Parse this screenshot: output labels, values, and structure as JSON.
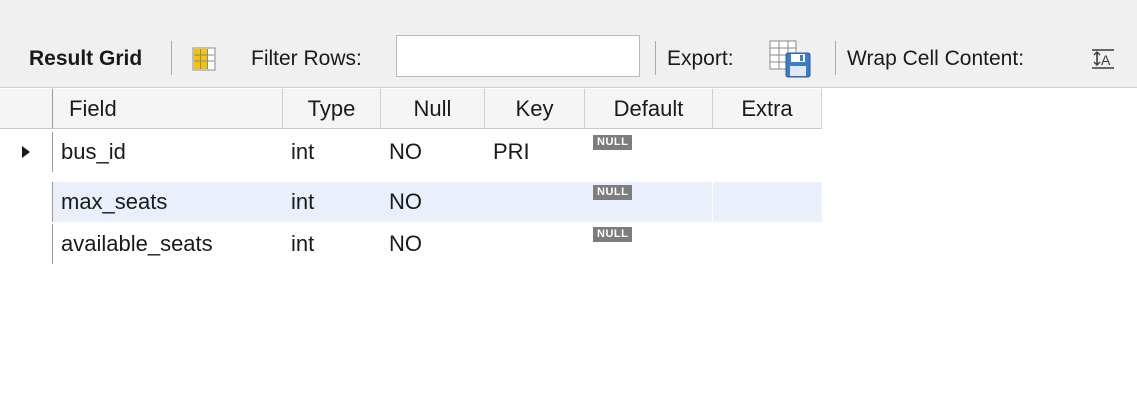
{
  "toolbar": {
    "result_grid_label": "Result Grid",
    "filter_rows_label": "Filter Rows:",
    "filter_rows_value": "",
    "export_label": "Export:",
    "wrap_label": "Wrap Cell Content:",
    "grid_icon": "grid-layout-icon",
    "export_icon": "export-save-icon",
    "wrap_icon": "wrap-text-icon"
  },
  "table": {
    "columns": [
      "Field",
      "Type",
      "Null",
      "Key",
      "Default",
      "Extra"
    ],
    "rows": [
      {
        "field": "bus_id",
        "type": "int",
        "null": "NO",
        "key": "PRI",
        "default": "NULL",
        "extra": "",
        "selected": true
      },
      {
        "field": "max_seats",
        "type": "int",
        "null": "NO",
        "key": "",
        "default": "NULL",
        "extra": "",
        "selected": false
      },
      {
        "field": "available_seats",
        "type": "int",
        "null": "NO",
        "key": "",
        "default": "NULL",
        "extra": "",
        "selected": false
      }
    ]
  },
  "colors": {
    "toolbar_bg": "#f0f0f0",
    "alt_row_bg": "#e9f0fb",
    "null_badge_bg": "#7d7d7d",
    "grid_icon_yellow": "#f5c400"
  }
}
